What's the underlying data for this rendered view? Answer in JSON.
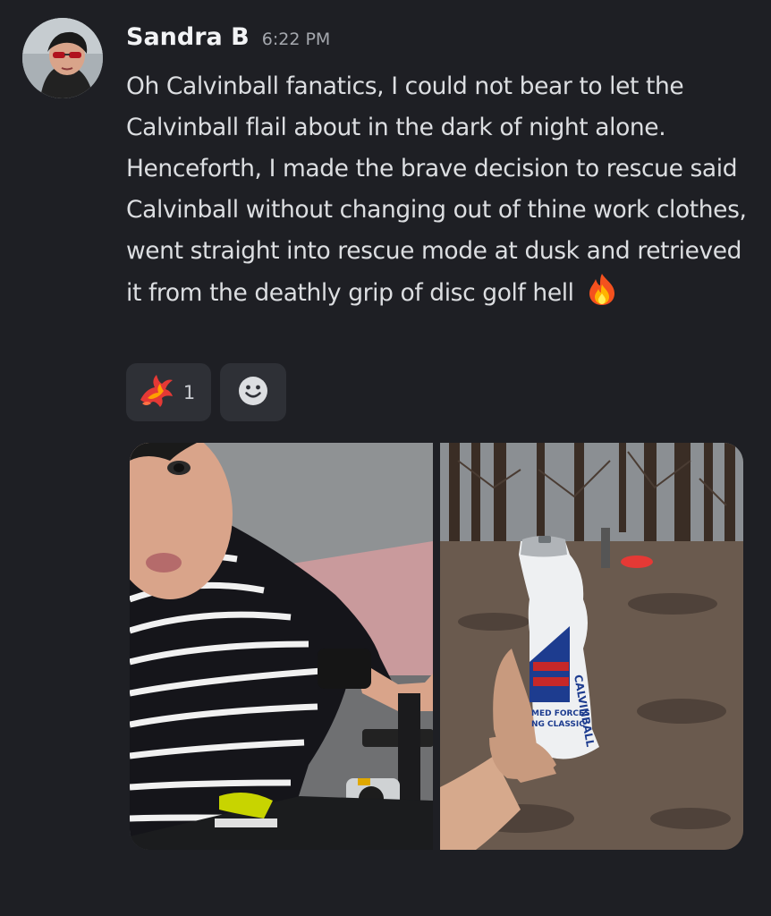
{
  "message": {
    "author": "Sandra B",
    "timestamp": "6:22 PM",
    "text": "Oh Calvinball fanatics, I could not bear to let the Calvinball flail about in the dark of night alone. Henceforth, I made the brave decision to rescue said Calvinball without changing out of thine work clothes, went straight into rescue mode at dusk and retrieved it from the deathly grip of disc golf hell",
    "trailing_emoji": "fire-icon"
  },
  "reactions": [
    {
      "emoji": "phoenix-icon",
      "count": "1"
    },
    {
      "emoji": "add-reaction-smile-icon"
    }
  ],
  "attachments": [
    {
      "kind": "image",
      "subject": "selfie-on-bicycle"
    },
    {
      "kind": "image",
      "subject": "water-bottle-in-woods"
    }
  ],
  "colors": {
    "background": "#1e1f24",
    "text": "#dcdee1",
    "username": "#f2f3f5",
    "reaction_bg": "#2e3036"
  }
}
